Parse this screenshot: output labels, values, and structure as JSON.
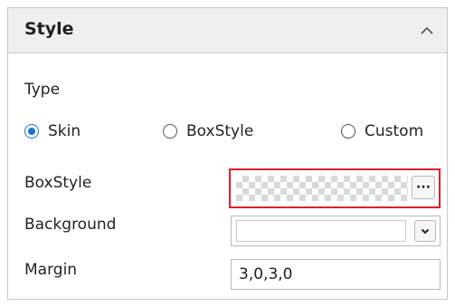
{
  "panel": {
    "title": "Style",
    "collapse_icon": "chevron-up-icon"
  },
  "type_section": {
    "label": "Type",
    "options": [
      {
        "label": "Skin",
        "checked": true
      },
      {
        "label": "BoxStyle",
        "checked": false
      },
      {
        "label": "Custom",
        "checked": false
      }
    ]
  },
  "properties": {
    "boxstyle": {
      "label": "BoxStyle",
      "button_label": "···",
      "swatch": "transparent-checkerboard"
    },
    "background": {
      "label": "Background",
      "value_color": "#ffffff",
      "dropdown_icon": "chevron-down-icon"
    },
    "margin": {
      "label": "Margin",
      "value": "3,0,3,0"
    }
  },
  "colors": {
    "accent": "#1a73d9",
    "highlight_border": "#e0202a",
    "header_bg": "#efefef"
  }
}
